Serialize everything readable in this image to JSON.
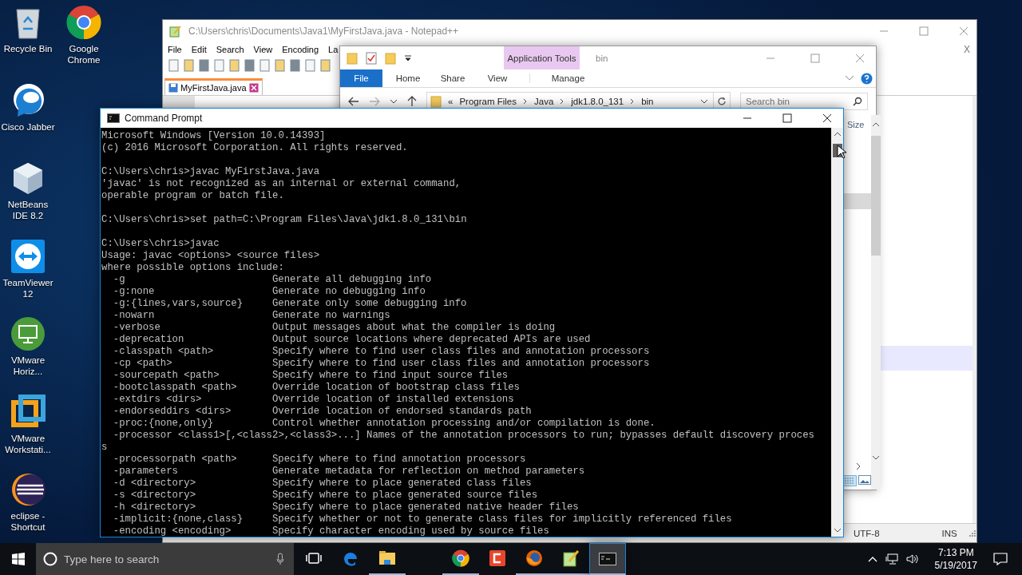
{
  "desktop": {
    "icon_columns": [
      [
        {
          "kind": "recycle",
          "label": "Recycle Bin"
        },
        {
          "kind": "jabber",
          "label": "Cisco Jabber"
        },
        {
          "kind": "netbeans",
          "label": "NetBeans IDE 8.2"
        },
        {
          "kind": "teamviewer",
          "label": "TeamViewer 12"
        },
        {
          "kind": "horizon",
          "label": "VMware Horiz..."
        },
        {
          "kind": "workstation",
          "label": "VMware Workstati..."
        },
        {
          "kind": "eclipse",
          "label": "eclipse - Shortcut"
        }
      ],
      [
        {
          "kind": "chrome",
          "label": "Google Chrome"
        }
      ]
    ]
  },
  "notepad": {
    "title": "C:\\Users\\chris\\Documents\\Java1\\MyFirstJava.java - Notepad++",
    "menu": [
      "File",
      "Edit",
      "Search",
      "View",
      "Encoding",
      "La"
    ],
    "tab": {
      "label": "MyFirstJava.java",
      "selected": true
    },
    "close_document": "X",
    "status_bar": [
      "UTF-8",
      "INS"
    ]
  },
  "explorer": {
    "title": "bin",
    "context_tab": "Application Tools",
    "file_tab": "File",
    "tabs": [
      "Home",
      "Share",
      "View"
    ],
    "context_subtab": "Manage",
    "path_overflow": "«",
    "path": [
      "Program Files",
      "Java",
      "jdk1.8.0_131",
      "bin"
    ],
    "search": {
      "placeholder": "Search bin"
    },
    "column": "Size"
  },
  "command_prompt": {
    "title": "Command Prompt",
    "lines": [
      {
        "kind": "text",
        "text": "Microsoft Windows [Version 10.0.14393]"
      },
      {
        "kind": "text",
        "text": "(c) 2016 Microsoft Corporation. All rights reserved."
      },
      {
        "kind": "blank"
      },
      {
        "kind": "text",
        "text": "C:\\Users\\chris>javac MyFirstJava.java"
      },
      {
        "kind": "text",
        "text": "'javac' is not recognized as an internal or external command,"
      },
      {
        "kind": "text",
        "text": "operable program or batch file."
      },
      {
        "kind": "blank"
      },
      {
        "kind": "text",
        "text": "C:\\Users\\chris>set path=C:\\Program Files\\Java\\jdk1.8.0_131\\bin"
      },
      {
        "kind": "blank"
      },
      {
        "kind": "text",
        "text": "C:\\Users\\chris>javac"
      },
      {
        "kind": "text",
        "text": "Usage: javac <options> <source files>"
      },
      {
        "kind": "text",
        "text": "where possible options include:"
      },
      {
        "kind": "option",
        "option": "-g",
        "description": "Generate all debugging info"
      },
      {
        "kind": "option",
        "option": "-g:none",
        "description": "Generate no debugging info"
      },
      {
        "kind": "option",
        "option": "-g:{lines,vars,source}",
        "description": "Generate only some debugging info"
      },
      {
        "kind": "option",
        "option": "-nowarn",
        "description": "Generate no warnings"
      },
      {
        "kind": "option",
        "option": "-verbose",
        "description": "Output messages about what the compiler is doing"
      },
      {
        "kind": "option",
        "option": "-deprecation",
        "description": "Output source locations where deprecated APIs are used"
      },
      {
        "kind": "option",
        "option": "-classpath <path>",
        "description": "Specify where to find user class files and annotation processors"
      },
      {
        "kind": "option",
        "option": "-cp <path>",
        "description": "Specify where to find user class files and annotation processors"
      },
      {
        "kind": "option",
        "option": "-sourcepath <path>",
        "description": "Specify where to find input source files"
      },
      {
        "kind": "option",
        "option": "-bootclasspath <path>",
        "description": "Override location of bootstrap class files"
      },
      {
        "kind": "option",
        "option": "-extdirs <dirs>",
        "description": "Override location of installed extensions"
      },
      {
        "kind": "option",
        "option": "-endorseddirs <dirs>",
        "description": "Override location of endorsed standards path"
      },
      {
        "kind": "option",
        "option": "-proc:{none,only}",
        "description": "Control whether annotation processing and/or compilation is done."
      },
      {
        "kind": "text",
        "text": "  -processor <class1>[,<class2>,<class3>...] Names of the annotation processors to run; bypasses default discovery proces"
      },
      {
        "kind": "text",
        "text": "s"
      },
      {
        "kind": "option",
        "option": "-processorpath <path>",
        "description": "Specify where to find annotation processors"
      },
      {
        "kind": "option",
        "option": "-parameters",
        "description": "Generate metadata for reflection on method parameters"
      },
      {
        "kind": "option",
        "option": "-d <directory>",
        "description": "Specify where to place generated class files"
      },
      {
        "kind": "option",
        "option": "-s <directory>",
        "description": "Specify where to place generated source files"
      },
      {
        "kind": "option",
        "option": "-h <directory>",
        "description": "Specify where to place generated native header files"
      },
      {
        "kind": "option",
        "option": "-implicit:{none,class}",
        "description": "Specify whether or not to generate class files for implicitly referenced files"
      },
      {
        "kind": "option",
        "option": "-encoding <encoding>",
        "description": "Specify character encoding used by source files"
      }
    ]
  },
  "taskbar": {
    "search": {
      "placeholder": "Type here to search"
    },
    "apps": [
      {
        "kind": "taskview",
        "running": false,
        "active": false
      },
      {
        "kind": "edge",
        "running": false,
        "active": false
      },
      {
        "kind": "explorer",
        "running": true,
        "active": false
      },
      {
        "kind": "chrome",
        "running": true,
        "active": false
      },
      {
        "kind": "red",
        "running": false,
        "active": false
      },
      {
        "kind": "firefox",
        "running": true,
        "active": false
      },
      {
        "kind": "notepad",
        "running": true,
        "active": false
      },
      {
        "kind": "cmd",
        "running": true,
        "active": true
      }
    ],
    "clock": {
      "time": "7:13 PM",
      "date": "5/19/2017"
    }
  }
}
